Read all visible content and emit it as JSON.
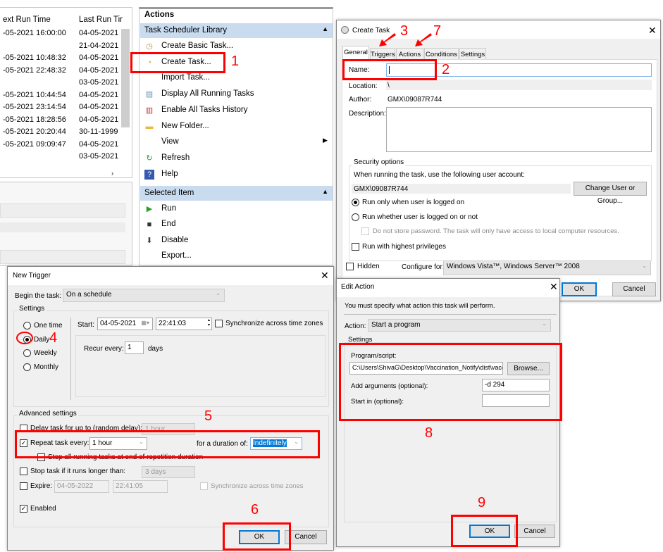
{
  "task_list": {
    "columns": [
      "ext Run Time",
      "Last Run Tir"
    ],
    "rows": [
      [
        "-05-2021 16:00:00",
        "04-05-2021"
      ],
      [
        "",
        "21-04-2021"
      ],
      [
        "-05-2021 10:48:32",
        "04-05-2021"
      ],
      [
        "-05-2021 22:48:32",
        "04-05-2021"
      ],
      [
        "",
        "03-05-2021"
      ],
      [
        "-05-2021 10:44:54",
        "04-05-2021"
      ],
      [
        "-05-2021 23:14:54",
        "04-05-2021"
      ],
      [
        "-05-2021 18:28:56",
        "04-05-2021"
      ],
      [
        "-05-2021 20:20:44",
        "30-11-1999"
      ],
      [
        "-05-2021 09:09:47",
        "04-05-2021"
      ],
      [
        "",
        "03-05-2021"
      ]
    ]
  },
  "actions": {
    "title": "Actions",
    "library_section": "Task Scheduler Library",
    "library_items": [
      {
        "label": "Create Basic Task...",
        "icon": "clock-wizard-icon"
      },
      {
        "label": "Create Task...",
        "icon": "task-icon"
      },
      {
        "label": "Import Task...",
        "icon": ""
      },
      {
        "label": "Display All Running Tasks",
        "icon": "running-tasks-icon"
      },
      {
        "label": "Enable All Tasks History",
        "icon": "history-icon"
      },
      {
        "label": "New Folder...",
        "icon": "folder-icon"
      },
      {
        "label": "View",
        "icon": ""
      },
      {
        "label": "Refresh",
        "icon": "refresh-icon"
      },
      {
        "label": "Help",
        "icon": "help-icon"
      }
    ],
    "selected_section": "Selected Item",
    "selected_items": [
      {
        "label": "Run",
        "icon": "play-icon"
      },
      {
        "label": "End",
        "icon": "stop-icon"
      },
      {
        "label": "Disable",
        "icon": "disable-icon"
      },
      {
        "label": "Export...",
        "icon": ""
      }
    ]
  },
  "create_task": {
    "title": "Create Task",
    "tabs": [
      "General",
      "Triggers",
      "Actions",
      "Conditions",
      "Settings"
    ],
    "name_label": "Name:",
    "name_value": "",
    "location_label": "Location:",
    "location_value": "\\",
    "author_label": "Author:",
    "author_value": "GMX\\09087R744",
    "description_label": "Description:",
    "security_title": "Security options",
    "account_prompt": "When running the task, use the following user account:",
    "account_value": "GMX\\09087R744",
    "change_user": "Change User or Group...",
    "radio_logged_on": "Run only when user is logged on",
    "radio_whether": "Run whether user is logged on or not",
    "no_store_pw": "Do not store password.  The task will only have access to local computer resources.",
    "highest": "Run with highest privileges",
    "hidden": "Hidden",
    "configure_label": "Configure for:",
    "configure_value": "Windows Vista™, Windows Server™ 2008",
    "ok": "OK",
    "cancel": "Cancel"
  },
  "new_trigger": {
    "title": "New Trigger",
    "begin_label": "Begin the task:",
    "begin_value": "On a schedule",
    "settings_title": "Settings",
    "schedules": [
      {
        "label": "One time",
        "checked": false
      },
      {
        "label": "Daily",
        "checked": true
      },
      {
        "label": "Weekly",
        "checked": false
      },
      {
        "label": "Monthly",
        "checked": false
      }
    ],
    "start_label": "Start:",
    "start_date": "04-05-2021",
    "start_time": "22:41:03",
    "sync": "Synchronize across time zones",
    "recur_label": "Recur every:",
    "recur_value": "1",
    "recur_unit": "days",
    "advanced_title": "Advanced settings",
    "delay_label": "Delay task for up to (random delay):",
    "delay_value": "1 hour",
    "repeat_label": "Repeat task every:",
    "repeat_value": "1 hour",
    "duration_label": "for a duration of:",
    "duration_value": "Indefinitely",
    "stop_all": "Stop all running tasks at end of repetition duration",
    "stop_longer": "Stop task if it runs longer than:",
    "stop_longer_value": "3 days",
    "expire_label": "Expire:",
    "expire_date": "04-05-2022",
    "expire_time": "22:41:05",
    "expire_sync": "Synchronize across time zones",
    "enabled": "Enabled",
    "ok": "OK",
    "cancel": "Cancel"
  },
  "edit_action": {
    "title": "Edit Action",
    "prompt": "You must specify what action this task will perform.",
    "action_label": "Action:",
    "action_value": "Start a program",
    "settings_title": "Settings",
    "program_label": "Program/script:",
    "program_value": "C:\\Users\\ShivaG\\Desktop\\Vaccination_Notify\\dist\\vaccinati",
    "browse": "Browse...",
    "args_label": "Add arguments (optional):",
    "args_value": "-d 294",
    "startin_label": "Start in (optional):",
    "startin_value": "",
    "ok": "OK",
    "cancel": "Cancel"
  },
  "annotations": [
    "1",
    "2",
    "3",
    "4",
    "5",
    "6",
    "7",
    "8",
    "9"
  ],
  "colors": {
    "annotation": "#ff0000",
    "section_header": "#c9dbef",
    "selection": "#0078d7"
  }
}
